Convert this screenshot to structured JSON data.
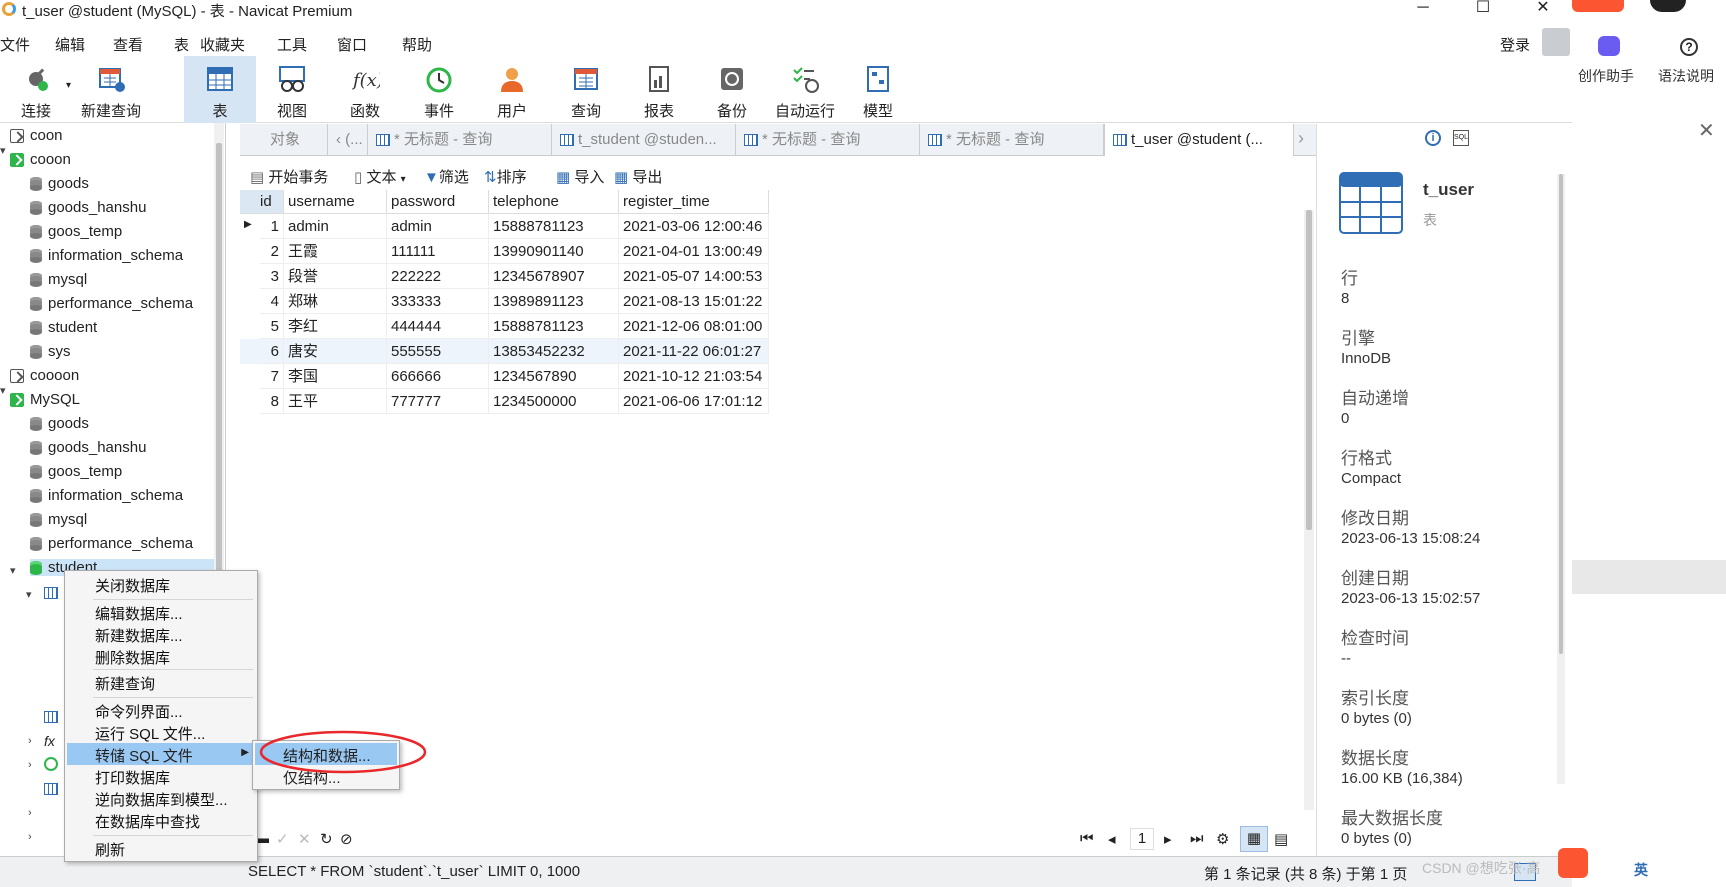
{
  "window": {
    "title": "t_user @student (MySQL) - 表 - Navicat Premium",
    "login": "登录"
  },
  "menu": [
    "文件",
    "编辑",
    "查看",
    "表",
    "收藏夹",
    "工具",
    "窗口",
    "帮助"
  ],
  "toolbar": {
    "connect": "连接",
    "new_query": "新建查询",
    "items": [
      "表",
      "视图",
      "函数",
      "事件",
      "用户",
      "查询",
      "报表",
      "备份",
      "自动运行",
      "模型"
    ]
  },
  "tree": {
    "conn1": "coon",
    "conn2": "cooon",
    "dbs2": [
      "goods",
      "goods_hanshu",
      "goos_temp",
      "information_schema",
      "mysql",
      "performance_schema",
      "student",
      "sys"
    ],
    "conn3": "coooon",
    "conn4": "MySQL",
    "dbs4": [
      "goods",
      "goods_hanshu",
      "goos_temp",
      "information_schema",
      "mysql",
      "performance_schema",
      "student"
    ]
  },
  "tabs": {
    "objects": "对象",
    "t1": "(...",
    "t2": "* 无标题 - 查询",
    "t3": "t_student @studen...",
    "t4": "* 无标题 - 查询",
    "t5": "* 无标题 - 查询",
    "t6": "t_user @student (..."
  },
  "subtoolbar": {
    "begin_tx": "开始事务",
    "text": "文本",
    "filter": "筛选",
    "sort": "排序",
    "import": "导入",
    "export": "导出"
  },
  "grid": {
    "columns": [
      "id",
      "username",
      "password",
      "telephone",
      "register_time"
    ],
    "rows": [
      [
        "1",
        "admin",
        "admin",
        "15888781123",
        "2021-03-06 12:00:46"
      ],
      [
        "2",
        "王霞",
        "111111",
        "13990901140",
        "2021-04-01 13:00:49"
      ],
      [
        "3",
        "段誉",
        "222222",
        "12345678907",
        "2021-05-07 14:00:53"
      ],
      [
        "4",
        "郑琳",
        "333333",
        "13989891123",
        "2021-08-13 15:01:22"
      ],
      [
        "5",
        "李红",
        "444444",
        "15888781123",
        "2021-12-06 08:01:00"
      ],
      [
        "6",
        "唐安",
        "555555",
        "13853452232",
        "2021-11-22 06:01:27"
      ],
      [
        "7",
        "李国",
        "666666",
        "1234567890",
        "2021-10-12 21:03:54"
      ],
      [
        "8",
        "王平",
        "777777",
        "1234500000",
        "2021-06-06 17:01:12"
      ]
    ]
  },
  "info": {
    "name": "t_user",
    "type": "表",
    "props": [
      {
        "label": "行",
        "value": "8"
      },
      {
        "label": "引擎",
        "value": "InnoDB"
      },
      {
        "label": "自动递增",
        "value": "0"
      },
      {
        "label": "行格式",
        "value": "Compact"
      },
      {
        "label": "修改日期",
        "value": "2023-06-13 15:08:24"
      },
      {
        "label": "创建日期",
        "value": "2023-06-13 15:02:57"
      },
      {
        "label": "检查时间",
        "value": "--"
      },
      {
        "label": "索引长度",
        "value": "0 bytes (0)"
      },
      {
        "label": "数据长度",
        "value": "16.00 KB (16,384)"
      },
      {
        "label": "最大数据长度",
        "value": "0 bytes (0)"
      }
    ]
  },
  "nav": {
    "page": "1"
  },
  "status": {
    "sql": "SELECT * FROM `student`.`t_user` LIMIT 0, 1000",
    "records": "第 1 条记录 (共 8 条) 于第 1 页"
  },
  "context_menu": {
    "items": [
      "关闭数据库",
      "编辑数据库...",
      "新建数据库...",
      "删除数据库",
      "新建查询",
      "命令列界面...",
      "运行 SQL 文件...",
      "转储 SQL 文件",
      "打印数据库",
      "逆向数据库到模型...",
      "在数据库中查找",
      "刷新"
    ],
    "submenu": [
      "结构和数据...",
      "仅结构..."
    ]
  },
  "side_app": {
    "creator": "创作助手",
    "grammar": "语法说明",
    "watermark": "CSDN @想吃张·高",
    "ime": "英"
  },
  "colors": {
    "accent": "#2f6db5",
    "selected": "#cce4f7",
    "highlight_circle": "#e8282b",
    "connected": "#2fb64a"
  }
}
